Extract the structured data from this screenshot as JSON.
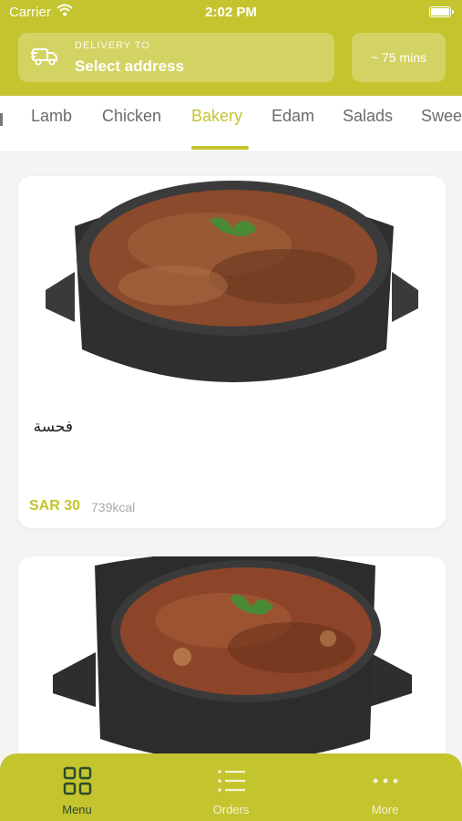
{
  "status_bar": {
    "carrier": "Carrier",
    "time": "2:02 PM"
  },
  "delivery": {
    "label": "DELIVERY TO",
    "address": "Select address",
    "eta": "~ 75 mins"
  },
  "tabs": [
    "Lamb",
    "Chicken",
    "Bakery",
    "Edam",
    "Salads",
    "Swee"
  ],
  "active_tab": "Bakery",
  "items": [
    {
      "name": "فحسة",
      "price": "SAR 30",
      "kcal": "739kcal"
    }
  ],
  "nav": {
    "menu": "Menu",
    "orders": "Orders",
    "more": "More"
  },
  "colors": {
    "brand": "#c4c42f",
    "nav_active": "#2c4a2a"
  },
  "icons": [
    "wifi-icon",
    "battery-icon",
    "truck-icon",
    "grid-icon",
    "list-icon",
    "dots-icon"
  ]
}
